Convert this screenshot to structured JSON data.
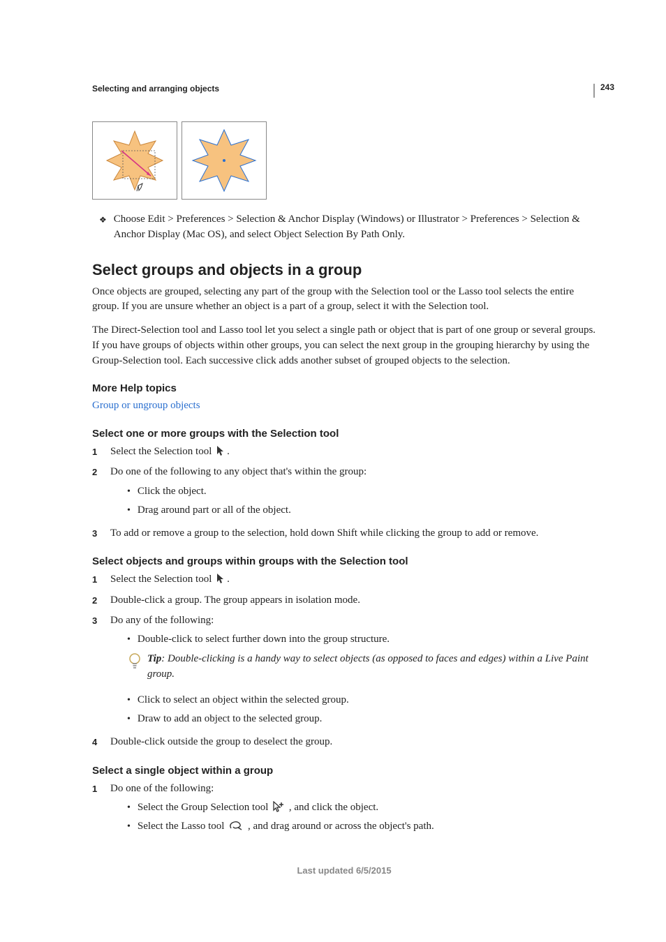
{
  "page_number": "243",
  "running_head": "Selecting and arranging objects",
  "pref_bullet": "Choose Edit > Preferences > Selection & Anchor Display (Windows) or Illustrator > Preferences > Selection & Anchor Display (Mac OS), and select Object Selection By Path Only.",
  "h2": "Select groups and objects in a group",
  "intro1": "Once objects are grouped, selecting any part of the group with the Selection tool or the Lasso tool selects the entire group. If you are unsure whether an object is a part of a group, select it with the Selection tool.",
  "intro2": "The Direct-Selection tool and Lasso tool let you select a single path or object that is part of one group or several groups. If you have groups of objects within other groups, you can select the next group in the grouping hierarchy by using the Group-Selection tool. Each successive click adds another subset of grouped objects to the selection.",
  "more_help": "More Help topics",
  "link1": "Group or ungroup objects",
  "sec1": {
    "title": "Select one or more groups with the Selection tool",
    "s1": "Select the Selection tool ",
    "s1_suffix": ".",
    "s2": "Do one of the following to any object that's within the group:",
    "s2a": "Click the object.",
    "s2b": "Drag around part or all of the object.",
    "s3": "To add or remove a group to the selection, hold down Shift while clicking the group to add or remove."
  },
  "sec2": {
    "title": "Select objects and groups within groups with the Selection tool",
    "s1": "Select the Selection tool ",
    "s1_suffix": ".",
    "s2": "Double-click a group. The group appears in isolation mode.",
    "s3": "Do any of the following:",
    "s3a": "Double-click to select further down into the group structure.",
    "tip_label": "Tip",
    "tip_text": ": Double-clicking is a handy way to select objects (as opposed to faces and edges) within a Live Paint group.",
    "s3b": "Click to select an object within the selected group.",
    "s3c": "Draw to add an object to the selected group.",
    "s4": "Double-click outside the group to deselect the group."
  },
  "sec3": {
    "title": "Select a single object within a group",
    "s1": "Do one of the following:",
    "s1a_pre": "Select the Group Selection tool ",
    "s1a_post": " , and click the object.",
    "s1b_pre": "Select the Lasso tool ",
    "s1b_post": " , and drag around or across the object's path."
  },
  "footer": "Last updated 6/5/2015"
}
